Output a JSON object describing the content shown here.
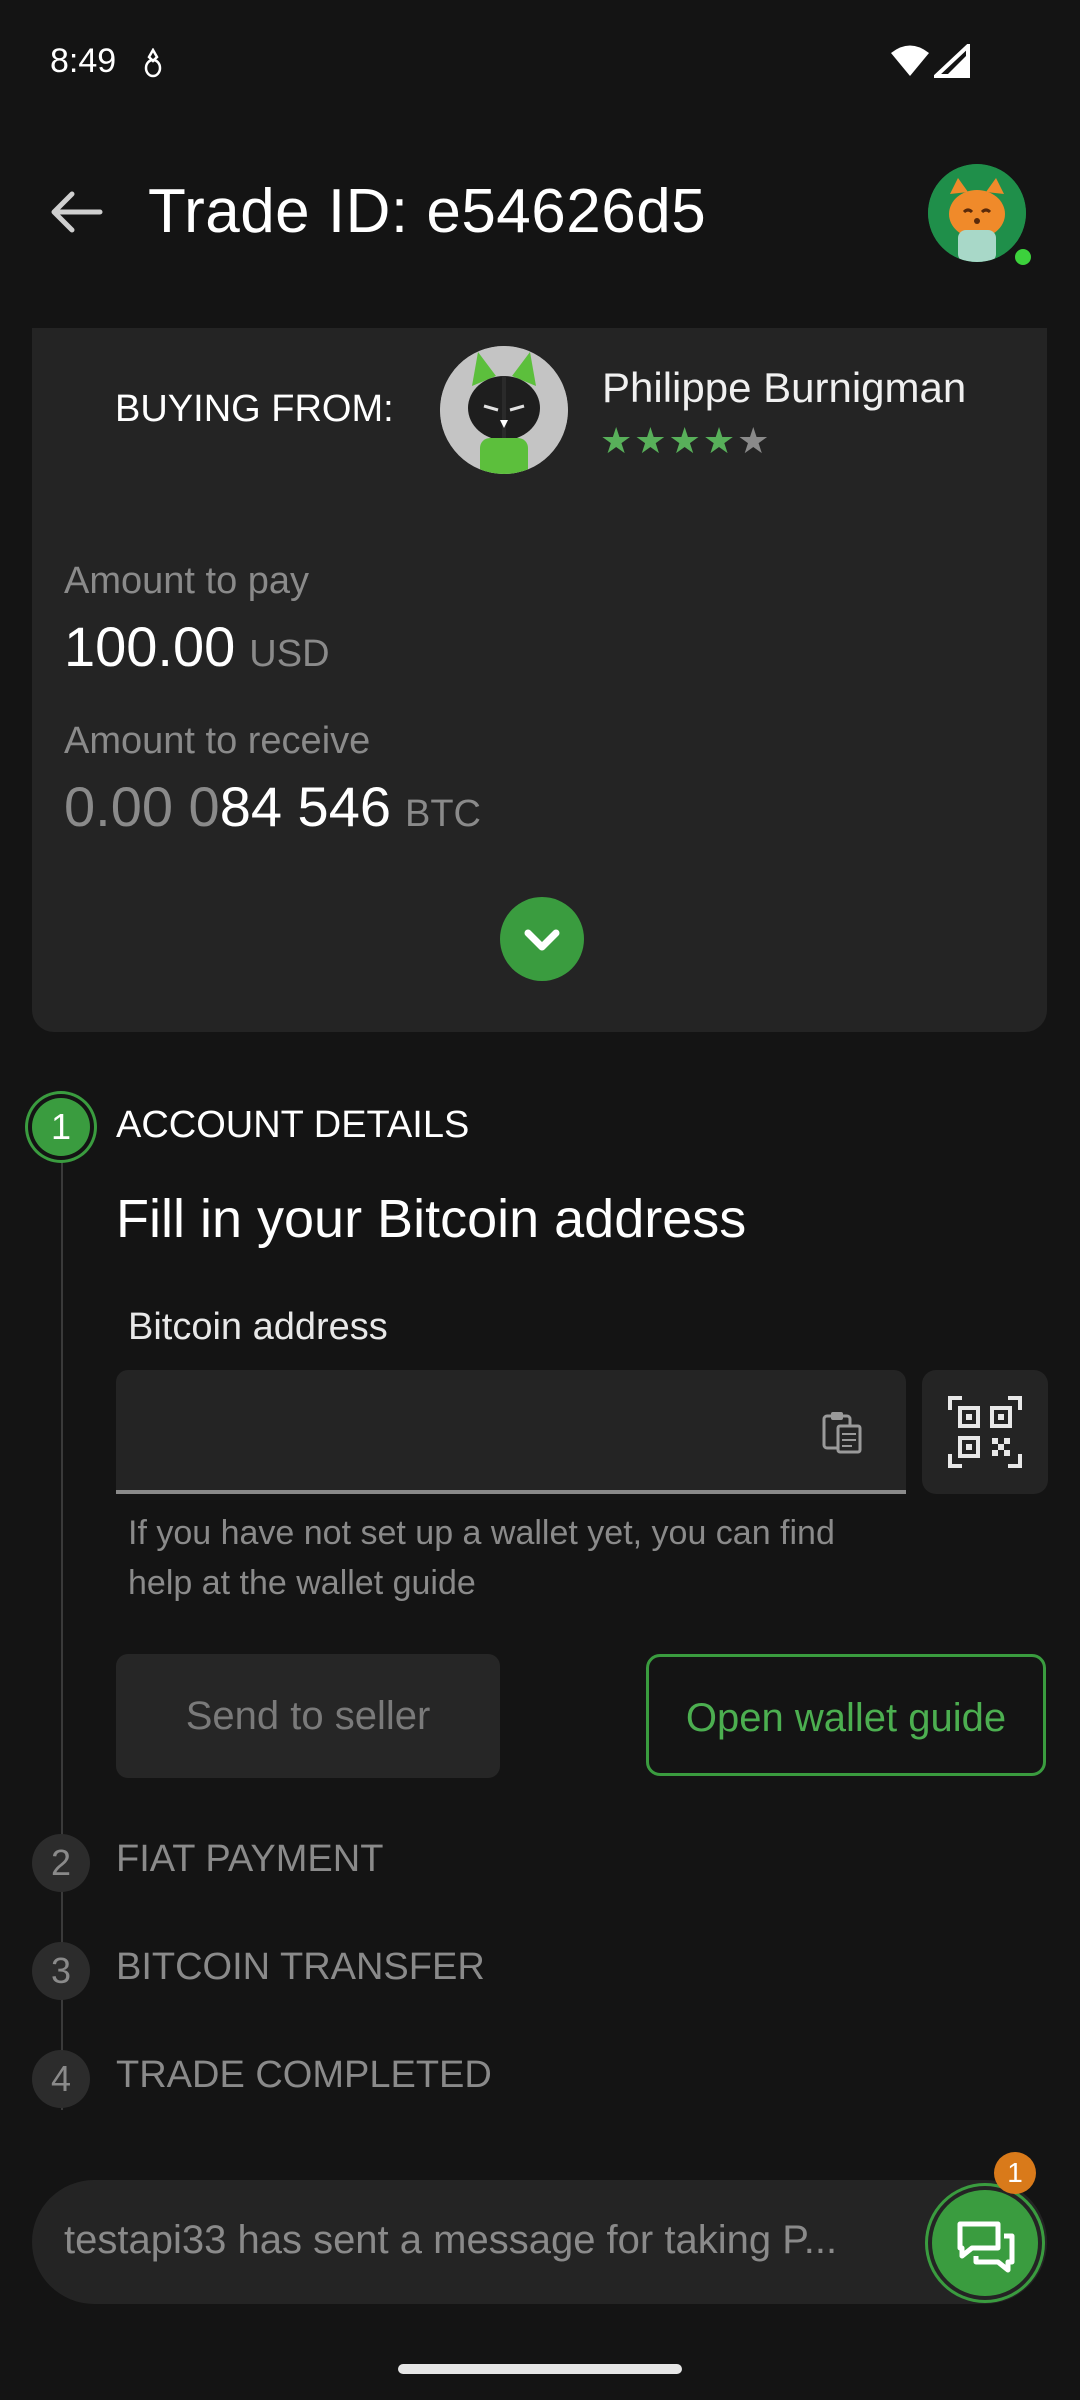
{
  "status_bar": {
    "time": "8:49"
  },
  "header": {
    "title": "Trade ID: e54626d5"
  },
  "trade_card": {
    "buying_label": "BUYING FROM:",
    "seller_name": "Philippe Burnigman",
    "seller_rating": 4.5,
    "amount_to_pay_label": "Amount to pay",
    "amount_to_pay": "100.00",
    "amount_to_pay_unit": "USD",
    "amount_to_receive_label": "Amount to receive",
    "amount_to_receive_dim": "0.00 0",
    "amount_to_receive_main": "84 546",
    "amount_to_receive_unit": "BTC"
  },
  "steps": {
    "step1": {
      "number": "1",
      "title": "ACCOUNT DETAILS"
    },
    "step2": {
      "number": "2",
      "title": "FIAT PAYMENT"
    },
    "step3": {
      "number": "3",
      "title": "BITCOIN TRANSFER"
    },
    "step4": {
      "number": "4",
      "title": "TRADE COMPLETED"
    }
  },
  "account_details": {
    "heading": "Fill in your Bitcoin address",
    "input_label": "Bitcoin address",
    "input_value": "",
    "helper_text": "If you have not set up a wallet yet, you can find help at the wallet guide",
    "send_button": "Send to seller",
    "guide_button": "Open wallet guide"
  },
  "chat": {
    "preview": "testapi33 has sent a message for taking P...",
    "unread_count": "1"
  },
  "colors": {
    "accent": "#3a9c3f",
    "background": "#141414",
    "card": "#242424",
    "badge": "#d97a1a"
  },
  "icons": [
    "tor-icon",
    "wifi-icon",
    "signal-icon",
    "back-arrow-icon",
    "paste-icon",
    "qr-scan-icon",
    "chevron-down-icon",
    "chat-icon"
  ]
}
